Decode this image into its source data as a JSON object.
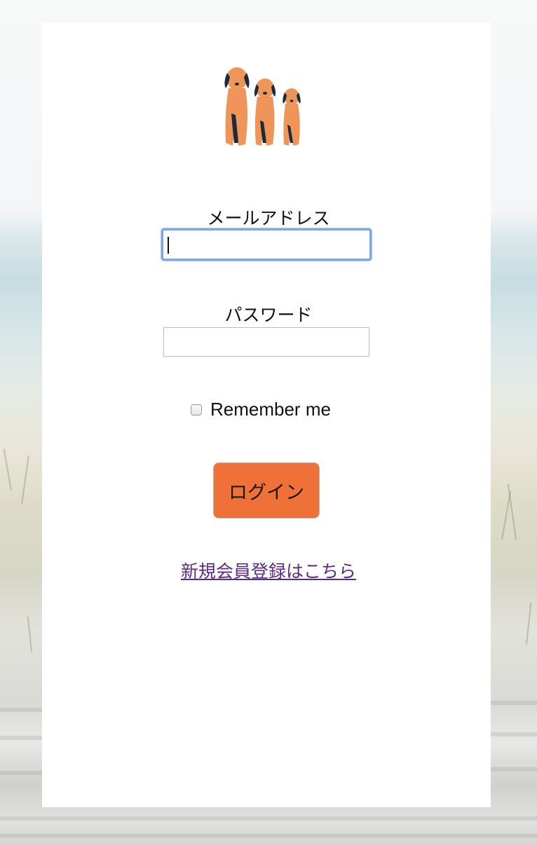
{
  "logo": {
    "icon": "three-dogs-icon",
    "color": "#f0955a"
  },
  "form": {
    "email_label": "メールアドレス",
    "email_value": "",
    "password_label": "パスワード",
    "password_value": "",
    "remember_label": "Remember me",
    "remember_checked": false,
    "login_label": "ログイン",
    "signup_link": "新規会員登録はこちら"
  },
  "colors": {
    "login_button": "#f07138",
    "link": "#5b2a86",
    "focus_ring": "#7aa7ee"
  }
}
